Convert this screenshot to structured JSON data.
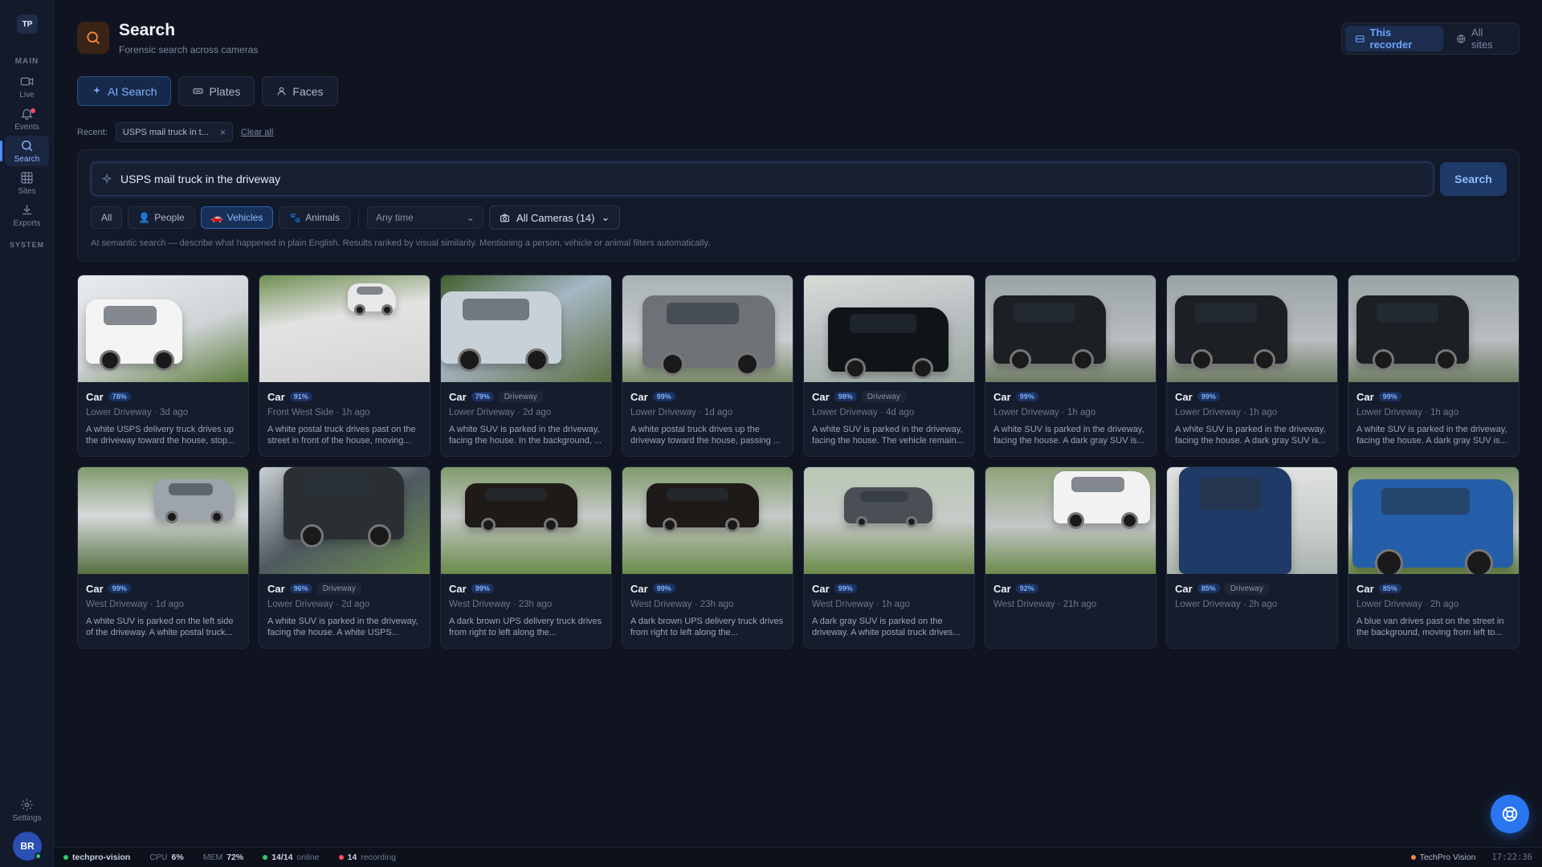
{
  "app": {
    "logo_text": "TP"
  },
  "sidebar": {
    "section_main": "MAIN",
    "section_system": "SYSTEM",
    "items": [
      {
        "label": "Live",
        "icon": "video-camera-icon"
      },
      {
        "label": "Events",
        "icon": "bell-icon"
      },
      {
        "label": "Search",
        "icon": "search-icon"
      },
      {
        "label": "Sites",
        "icon": "grid-icon"
      },
      {
        "label": "Exports",
        "icon": "download-icon"
      }
    ],
    "settings_label": "Settings",
    "avatar_initials": "BR"
  },
  "header": {
    "title": "Search",
    "subtitle": "Forensic search across cameras",
    "scope": {
      "this_recorder": "This recorder",
      "all_sites": "All sites"
    }
  },
  "tabs": [
    {
      "label": "AI Search",
      "active": true
    },
    {
      "label": "Plates",
      "active": false
    },
    {
      "label": "Faces",
      "active": false
    }
  ],
  "recent": {
    "label": "Recent:",
    "items": [
      {
        "text": "USPS mail truck in t..."
      }
    ],
    "clear_all": "Clear all"
  },
  "search": {
    "query": "USPS mail truck in the driveway",
    "button": "Search",
    "filters": {
      "all": "All",
      "people": "People",
      "vehicles": "Vehicles",
      "animals": "Animals",
      "time": "Any time",
      "cameras": "All Cameras (14)"
    },
    "hint": "AI semantic search — describe what happened in plain English. Results ranked by visual similarity. Mentioning a person, vehicle or animal filters automatically."
  },
  "results": [
    {
      "label": "Car",
      "score": "78%",
      "zone": "",
      "meta": "Lower Driveway · 3d ago",
      "desc": "A white USPS delivery truck drives up the driveway toward the house, stop..."
    },
    {
      "label": "Car",
      "score": "91%",
      "zone": "",
      "meta": "Front West Side · 1h ago",
      "desc": "A white postal truck drives past on the street in front of the house, moving..."
    },
    {
      "label": "Car",
      "score": "79%",
      "zone": "Driveway",
      "meta": "Lower Driveway · 2d ago",
      "desc": "A white SUV is parked in the driveway, facing the house. In the background, ..."
    },
    {
      "label": "Car",
      "score": "99%",
      "zone": "",
      "meta": "Lower Driveway · 1d ago",
      "desc": "A white postal truck drives up the driveway toward the house, passing ..."
    },
    {
      "label": "Car",
      "score": "98%",
      "zone": "Driveway",
      "meta": "Lower Driveway · 4d ago",
      "desc": "A white SUV is parked in the driveway, facing the house. The vehicle remain..."
    },
    {
      "label": "Car",
      "score": "99%",
      "zone": "",
      "meta": "Lower Driveway · 1h ago",
      "desc": "A white SUV is parked in the driveway, facing the house. A dark gray SUV is..."
    },
    {
      "label": "Car",
      "score": "99%",
      "zone": "",
      "meta": "Lower Driveway · 1h ago",
      "desc": "A white SUV is parked in the driveway, facing the house. A dark gray SUV is..."
    },
    {
      "label": "Car",
      "score": "99%",
      "zone": "",
      "meta": "Lower Driveway · 1h ago",
      "desc": "A white SUV is parked in the driveway, facing the house. A dark gray SUV is..."
    },
    {
      "label": "Car",
      "score": "99%",
      "zone": "",
      "meta": "West Driveway · 1d ago",
      "desc": "A white SUV is parked on the left side of the driveway. A white postal truck..."
    },
    {
      "label": "Car",
      "score": "96%",
      "zone": "Driveway",
      "meta": "Lower Driveway · 2d ago",
      "desc": "A white SUV is parked in the driveway, facing the house. A white USPS..."
    },
    {
      "label": "Car",
      "score": "99%",
      "zone": "",
      "meta": "West Driveway · 23h ago",
      "desc": "A dark brown UPS delivery truck drives from right to left along the..."
    },
    {
      "label": "Car",
      "score": "99%",
      "zone": "",
      "meta": "West Driveway · 23h ago",
      "desc": "A dark brown UPS delivery truck drives from right to left along the..."
    },
    {
      "label": "Car",
      "score": "99%",
      "zone": "",
      "meta": "West Driveway · 1h ago",
      "desc": "A dark gray SUV is parked on the driveway. A white postal truck drives..."
    },
    {
      "label": "Car",
      "score": "92%",
      "zone": "",
      "meta": "West Driveway · 21h ago",
      "desc": ""
    },
    {
      "label": "Car",
      "score": "85%",
      "zone": "Driveway",
      "meta": "Lower Driveway · 2h ago",
      "desc": ""
    },
    {
      "label": "Car",
      "score": "85%",
      "zone": "",
      "meta": "Lower Driveway · 2h ago",
      "desc": "A blue van drives past on the street in the background, moving from left to..."
    }
  ],
  "status": {
    "host": "techpro-vision",
    "cpu_label": "CPU",
    "cpu": "6%",
    "mem_label": "MEM",
    "mem": "72%",
    "online_count": "14/14",
    "online_label": "online",
    "recording_count": "14",
    "recording_label": "recording",
    "brand": "TechPro Vision",
    "clock": "17:22:36"
  },
  "colors": {
    "accent": "#4b8dff",
    "online": "#2ecc71",
    "alert": "#ff4d5e",
    "header_icon": "#f08a3c"
  }
}
